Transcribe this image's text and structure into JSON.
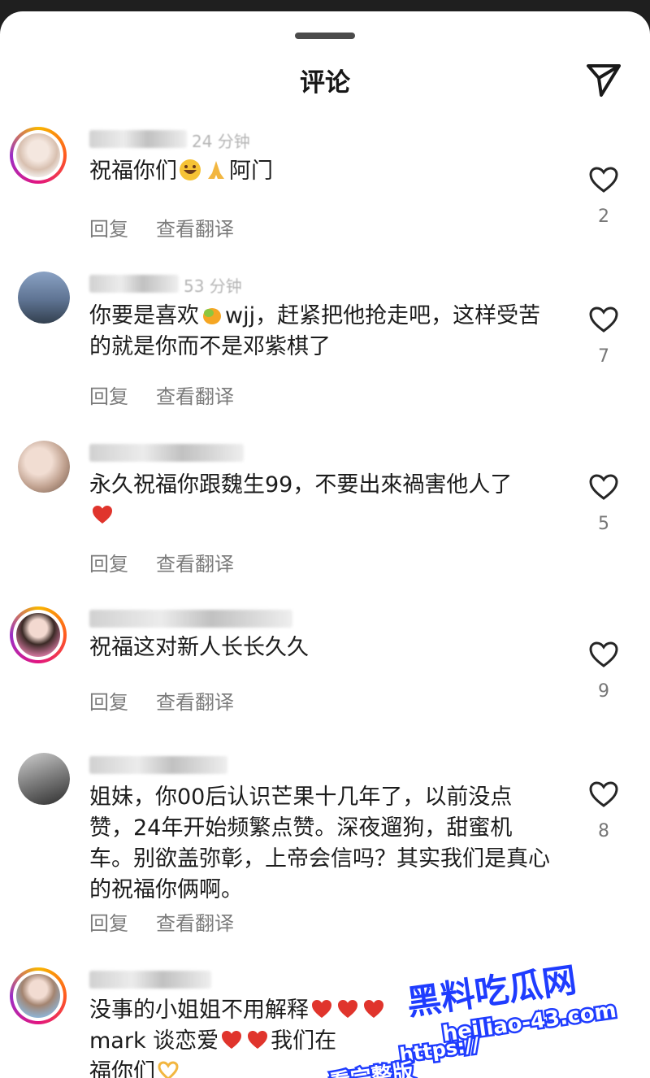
{
  "header": {
    "title": "评论"
  },
  "comments": [
    {
      "time": "24 分钟",
      "text": "祝福你们",
      "text_suffix": "阿门",
      "reply": "回复",
      "translate": "查看翻译",
      "likes": "2"
    },
    {
      "time": "53 分钟",
      "text": "你要是喜欢",
      "text_suffix": "wjj，赶紧把他抢走吧，这样受苦的就是你而不是邓紫棋了",
      "reply": "回复",
      "translate": "查看翻译",
      "likes": "7"
    },
    {
      "time": "",
      "text": "永久祝福你跟魏生99，不要出來禍害他人了",
      "reply": "回复",
      "translate": "查看翻译",
      "likes": "5"
    },
    {
      "time": "",
      "text": "祝福这对新人长长久久",
      "reply": "回复",
      "translate": "查看翻译",
      "likes": "9"
    },
    {
      "time": "",
      "text": "姐妹，你00后认识芒果十几年了，以前没点赞，24年开始频繁点赞。深夜遛狗，甜蜜机车。别欲盖弥彰，上帝会信吗？其实我们是真心的祝福你俩啊。",
      "reply": "回复",
      "translate": "查看翻译",
      "likes": "8"
    },
    {
      "time": "",
      "text": "没事的小姐姐不用解释",
      "text_line2": "mark 谈恋爱",
      "text_line2b": "我们在",
      "text_line3": "福你们"
    }
  ],
  "watermark": {
    "brand": "黑料吃瓜网",
    "url": "heiliao-43.com",
    "tagline": "看完整版",
    "link": "https://"
  },
  "icons": {
    "send": "paper-plane-icon",
    "like": "heart-outline-icon"
  },
  "colors": {
    "background": "#ffffff",
    "text": "#1c1c1c",
    "secondary": "#7b7b7b",
    "heart_red": "#e0342c",
    "watermark_blue": "#1f3cff"
  }
}
